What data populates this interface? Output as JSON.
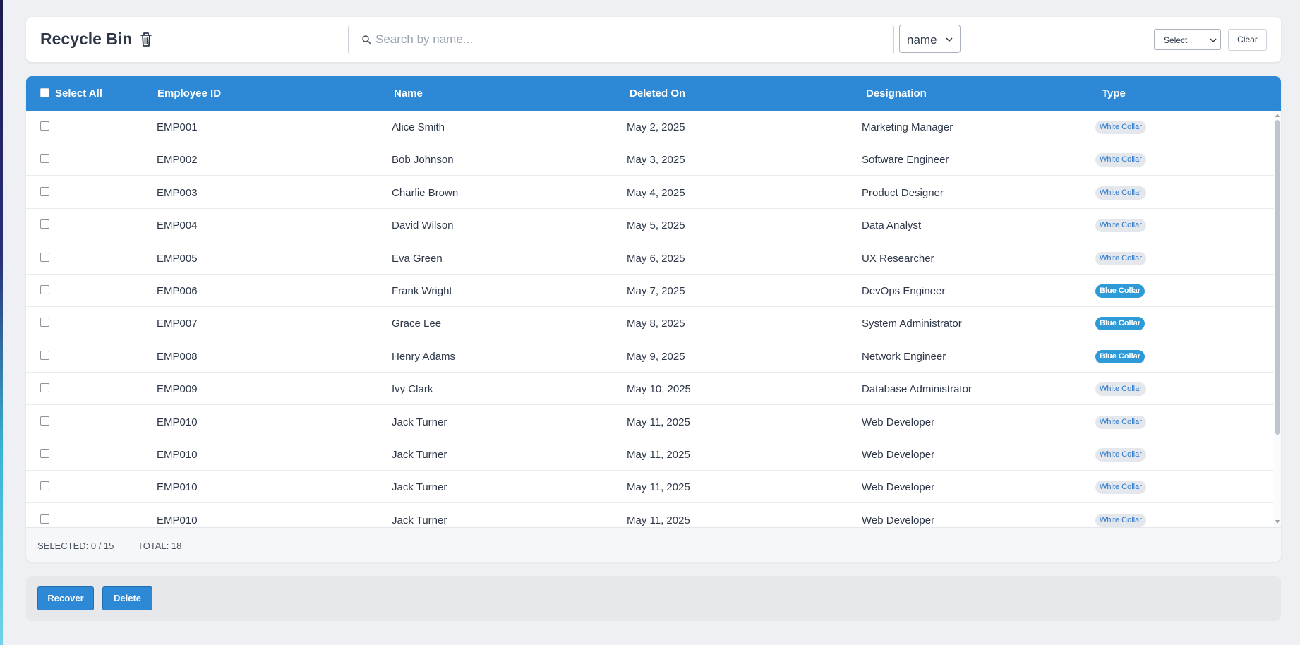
{
  "header": {
    "title": "Recycle Bin",
    "search_placeholder": "Search by name...",
    "search_value": "",
    "search_field": "name",
    "type_filter": "Select",
    "clear_label": "Clear"
  },
  "table": {
    "columns": {
      "select_all": "Select All",
      "employee_id": "Employee ID",
      "name": "Name",
      "deleted_on": "Deleted On",
      "designation": "Designation",
      "type": "Type"
    },
    "rows": [
      {
        "id": "EMP001",
        "name": "Alice Smith",
        "deleted_on": "May 2, 2025",
        "designation": "Marketing Manager",
        "type": "White Collar"
      },
      {
        "id": "EMP002",
        "name": "Bob Johnson",
        "deleted_on": "May 3, 2025",
        "designation": "Software Engineer",
        "type": "White Collar"
      },
      {
        "id": "EMP003",
        "name": "Charlie Brown",
        "deleted_on": "May 4, 2025",
        "designation": "Product Designer",
        "type": "White Collar"
      },
      {
        "id": "EMP004",
        "name": "David Wilson",
        "deleted_on": "May 5, 2025",
        "designation": "Data Analyst",
        "type": "White Collar"
      },
      {
        "id": "EMP005",
        "name": "Eva Green",
        "deleted_on": "May 6, 2025",
        "designation": "UX Researcher",
        "type": "White Collar"
      },
      {
        "id": "EMP006",
        "name": "Frank Wright",
        "deleted_on": "May 7, 2025",
        "designation": "DevOps Engineer",
        "type": "Blue Collar"
      },
      {
        "id": "EMP007",
        "name": "Grace Lee",
        "deleted_on": "May 8, 2025",
        "designation": "System Administrator",
        "type": "Blue Collar"
      },
      {
        "id": "EMP008",
        "name": "Henry Adams",
        "deleted_on": "May 9, 2025",
        "designation": "Network Engineer",
        "type": "Blue Collar"
      },
      {
        "id": "EMP009",
        "name": "Ivy Clark",
        "deleted_on": "May 10, 2025",
        "designation": "Database Administrator",
        "type": "White Collar"
      },
      {
        "id": "EMP010",
        "name": "Jack Turner",
        "deleted_on": "May 11, 2025",
        "designation": "Web Developer",
        "type": "White Collar"
      },
      {
        "id": "EMP010",
        "name": "Jack Turner",
        "deleted_on": "May 11, 2025",
        "designation": "Web Developer",
        "type": "White Collar"
      },
      {
        "id": "EMP010",
        "name": "Jack Turner",
        "deleted_on": "May 11, 2025",
        "designation": "Web Developer",
        "type": "White Collar"
      },
      {
        "id": "EMP010",
        "name": "Jack Turner",
        "deleted_on": "May 11, 2025",
        "designation": "Web Developer",
        "type": "White Collar"
      }
    ]
  },
  "footer": {
    "selected_text": "SELECTED: 0 / 15",
    "total_text": "TOTAL: 18"
  },
  "actions": {
    "recover_label": "Recover",
    "delete_label": "Delete"
  },
  "colors": {
    "accent": "#2d89d6",
    "blue_collar_badge": "#2e9ad8",
    "white_collar_badge": "#e4e8ed"
  }
}
